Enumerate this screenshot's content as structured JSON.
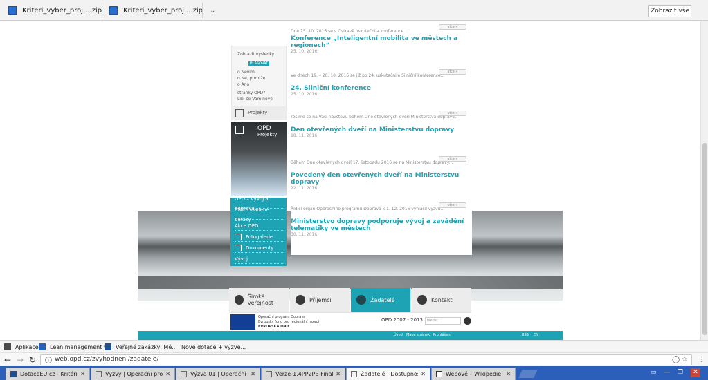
{
  "downloads": {
    "items": [
      {
        "name": "Kriteri_vyber_proj....zip"
      },
      {
        "name": "Kriteri_vyber_proj....zip"
      }
    ],
    "show_all": "Zobrazit vše"
  },
  "page": {
    "info_panel": {
      "lines": [
        "Líbí se Vám nové",
        "stránky OPD?",
        "o Ano",
        "o Ne, protože",
        "o Nevím"
      ],
      "button_label": "HLASOVAT",
      "results_link": "Zobrazit výsledky"
    },
    "sidebar_tiles": {
      "projects": "Projekty",
      "opd": "OPD"
    },
    "menu": [
      "Vývoj",
      "Dokumenty",
      "Fotogalerie",
      "Akce OPD",
      "Často kladené dotazy",
      "OPD – Vývoj a doprava"
    ],
    "news": [
      {
        "date": "25. 10. 2016",
        "title": "Konference „Inteligentní mobilita ve městech a regionech“",
        "excerpt": "Dne 25. 10. 2016 se v Ostravě uskutečnila konference...",
        "more": "více »"
      },
      {
        "date": "25. 10. 2016",
        "title": "24. Silniční konference",
        "excerpt": "Ve dnech 19. – 20. 10. 2016 se již po 24. uskutečnila Silniční konference...",
        "more": "více »"
      },
      {
        "date": "18. 11. 2016",
        "title": "Den otevřených dveří na Ministerstvu dopravy",
        "excerpt": "Těšíme se na Vaši návštěvu během Dne otevřených dveří Ministerstva dopravy...",
        "more": "více »"
      },
      {
        "date": "22. 11. 2016",
        "title": "Povedený den otevřených dveří na Ministerstvu dopravy",
        "excerpt": "Během Dne otevřených dveří 17. listopadu 2016 se na Ministerstvu dopravy...",
        "more": "více »"
      },
      {
        "date": "30. 11. 2016",
        "title": "Ministerstvo dopravy podporuje vývoj a zavádění telematiky ve městech",
        "excerpt": "Řídicí orgán Operačního programu Doprava k 1. 12. 2016 vyhlásil výzvu...",
        "more": "více »"
      }
    ],
    "tiles": [
      {
        "label": "Široká veřejnost",
        "active": false
      },
      {
        "label": "Příjemci",
        "active": false
      },
      {
        "label": "Žadatelé",
        "active": true
      },
      {
        "label": "Kontakt",
        "active": false
      }
    ],
    "eu": {
      "line1": "EVROPSKÁ UNIE",
      "line2": "Evropský fond pro regionální rozvoj",
      "line3": "Operační program Doprava"
    },
    "opd_logo": "OPD 2007 - 2013",
    "search_placeholder": "hledat",
    "footer_links": [
      "Úvod",
      "Mapa stránek",
      "Prohlášení",
      "RSS",
      "EN"
    ]
  },
  "bookmarks": [
    {
      "label": "Aplikace",
      "color": "#4a4a4a"
    },
    {
      "label": "Lean management v...",
      "color": "#2a62b8"
    },
    {
      "label": "Veřejné zakázky, Mě...",
      "color": "#1f4f8f"
    },
    {
      "label": "Nové dotace + výzve...",
      "color": "#888888"
    }
  ],
  "address": {
    "url": "web.opd.cz/zvyhodneni/zadatele/",
    "secure_hint": "i"
  },
  "tabs": [
    {
      "title": "DotaceEU.cz - Kritéria",
      "color": "#1f4f8f",
      "active": false
    },
    {
      "title": "Výzvy | Operační progra",
      "color": "#6a6a6a",
      "active": false
    },
    {
      "title": "Výzva 01 | Operační pro",
      "color": "#6a6a6a",
      "active": false
    },
    {
      "title": "Verze-1.4PP2PE-Final",
      "color": "#6a6a6a",
      "active": false
    },
    {
      "title": "Žadatelé | Dostupnost |",
      "color": "#6a6a6a",
      "active": true
    },
    {
      "title": "Webové – Wikipedie",
      "color": "#333333",
      "active": false
    }
  ],
  "accent_color": "#1da3b3"
}
